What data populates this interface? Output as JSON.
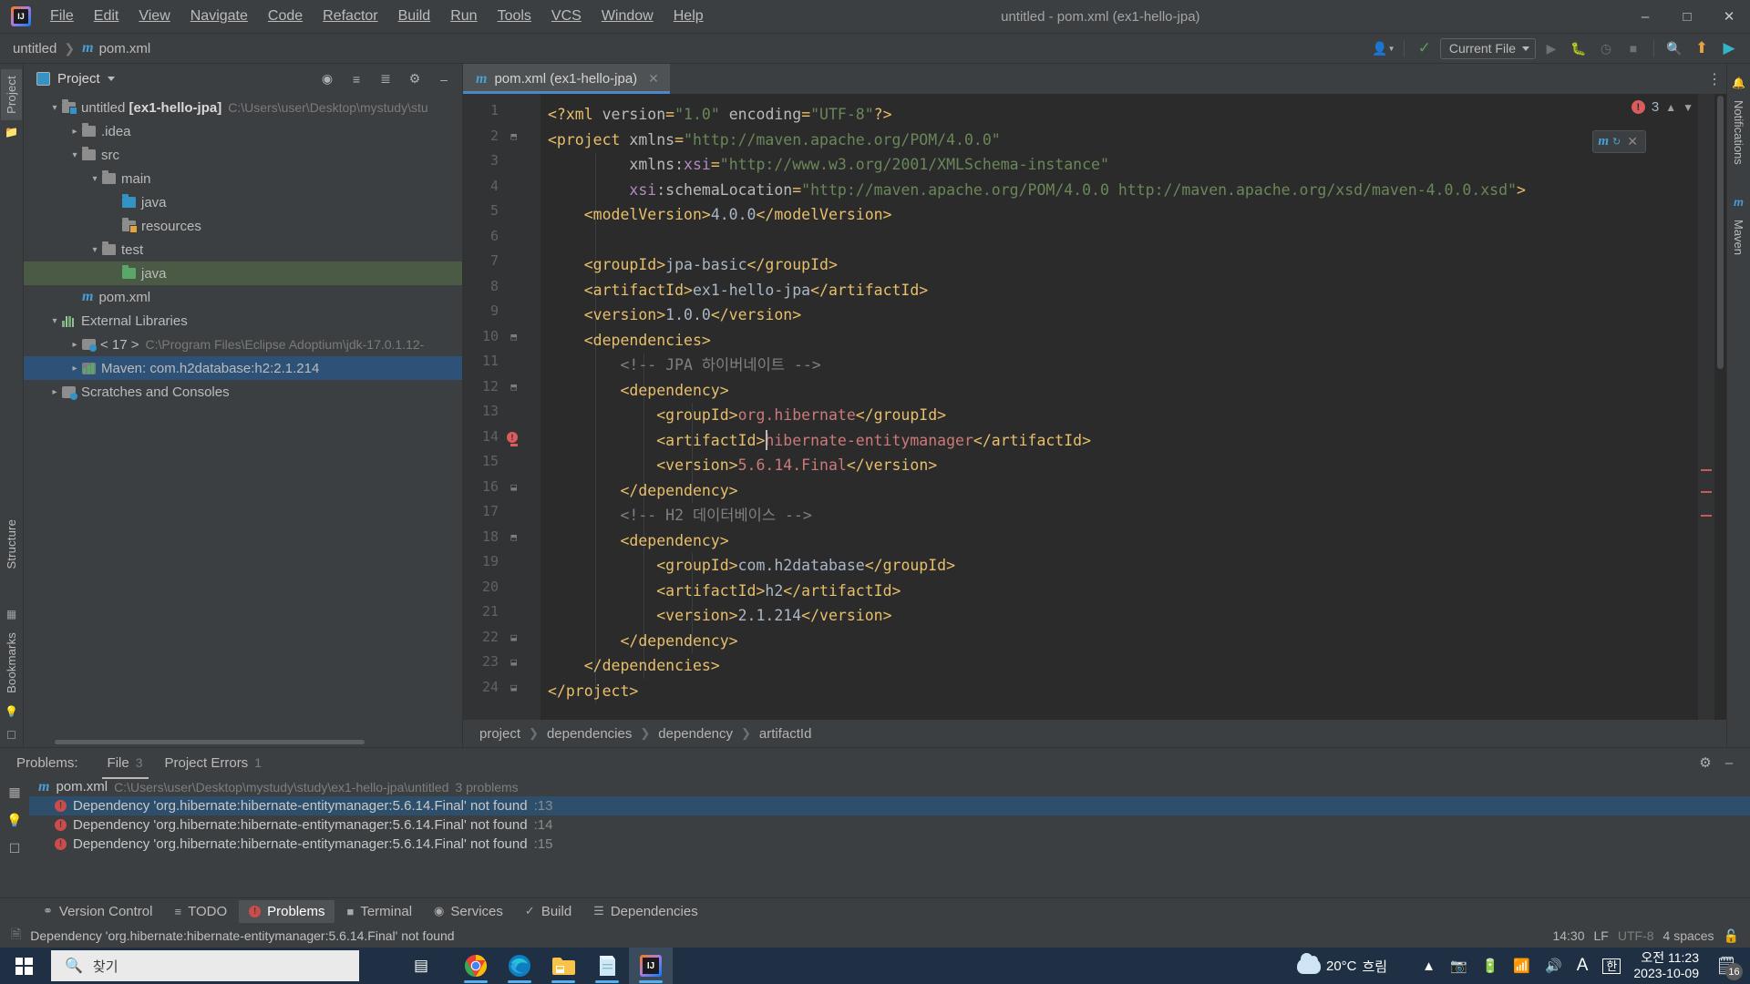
{
  "window": {
    "title": "untitled - pom.xml (ex1-hello-jpa)"
  },
  "menubar": {
    "items": [
      "File",
      "Edit",
      "View",
      "Navigate",
      "Code",
      "Refactor",
      "Build",
      "Run",
      "Tools",
      "VCS",
      "Window",
      "Help"
    ]
  },
  "navbar": {
    "crumbs": [
      "untitled",
      "pom.xml"
    ],
    "run_config": "Current File",
    "icons": [
      "account-icon",
      "hammer-build-icon",
      "run-icon",
      "debug-icon",
      "run-coverage-icon",
      "stop-icon",
      "search-everywhere-icon",
      "update-project-icon",
      "ide-services-icon"
    ]
  },
  "window_controls": {
    "minimize": "minimize-icon",
    "maximize": "maximize-icon",
    "close": "close-icon"
  },
  "left_strip": {
    "tabs": [
      "Project",
      "Structure",
      "Bookmarks"
    ]
  },
  "right_strip": {
    "tabs": [
      "Notifications",
      "Maven"
    ]
  },
  "project_panel": {
    "title": "Project",
    "header_icons": [
      "locate-file-icon",
      "expand-all-icon",
      "collapse-all-icon",
      "settings-gear-icon",
      "hide-panel-icon"
    ],
    "tree": [
      {
        "depth": 0,
        "arrow": "down",
        "icon": "module-folder-icon",
        "label": "untitled",
        "bold": "[ex1-hello-jpa]",
        "path": "C:\\Users\\user\\Desktop\\mystudy\\stu",
        "state": "normal"
      },
      {
        "depth": 1,
        "arrow": "right",
        "icon": "folder-icon",
        "label": ".idea",
        "state": "normal"
      },
      {
        "depth": 1,
        "arrow": "down",
        "icon": "folder-icon",
        "label": "src",
        "state": "normal"
      },
      {
        "depth": 2,
        "arrow": "down",
        "icon": "folder-icon",
        "label": "main",
        "state": "normal"
      },
      {
        "depth": 3,
        "arrow": "none",
        "icon": "source-folder-icon",
        "label": "java",
        "state": "normal"
      },
      {
        "depth": 3,
        "arrow": "none",
        "icon": "resource-folder-icon",
        "label": "resources",
        "state": "normal"
      },
      {
        "depth": 2,
        "arrow": "down",
        "icon": "folder-icon",
        "label": "test",
        "state": "normal"
      },
      {
        "depth": 3,
        "arrow": "none",
        "icon": "test-source-folder-icon",
        "label": "java",
        "state": "selected-green"
      },
      {
        "depth": 1,
        "arrow": "none",
        "icon": "maven-file-icon",
        "label": "pom.xml",
        "state": "normal"
      },
      {
        "depth": 0,
        "arrow": "down",
        "icon": "external-libraries-icon",
        "label": "External Libraries",
        "state": "normal"
      },
      {
        "depth": 1,
        "arrow": "right",
        "icon": "jdk-icon",
        "label": "< 17 >",
        "path": "C:\\Program Files\\Eclipse Adoptium\\jdk-17.0.1.12-",
        "state": "normal"
      },
      {
        "depth": 1,
        "arrow": "right",
        "icon": "maven-library-icon",
        "label": "Maven: com.h2database:h2:2.1.214",
        "state": "selected-blue"
      },
      {
        "depth": 0,
        "arrow": "right",
        "icon": "scratches-icon",
        "label": "Scratches and Consoles",
        "state": "normal"
      }
    ]
  },
  "editor": {
    "tab": {
      "label": "pom.xml (ex1-hello-jpa)",
      "icon": "maven-file-icon",
      "close": "close-icon"
    },
    "inspection_widget": {
      "error_count": "3",
      "up": "chevron-up-icon",
      "down": "chevron-down-icon"
    },
    "float_widget": {
      "icon": "maven-refresh-icon",
      "close": "close-icon"
    },
    "breadcrumbs": [
      "project",
      "dependencies",
      "dependency",
      "artifactId"
    ],
    "total_lines": 24,
    "gutter_error_line": 14,
    "lines": [
      {
        "n": 1,
        "fold": "",
        "tokens": [
          {
            "t": "<?xml ",
            "c": "prolog"
          },
          {
            "t": "version",
            "c": "attrn"
          },
          {
            "t": "=",
            "c": "tagp"
          },
          {
            "t": "\"1.0\"",
            "c": "str"
          },
          {
            "t": " ",
            "c": "txt"
          },
          {
            "t": "encoding",
            "c": "attrn"
          },
          {
            "t": "=",
            "c": "tagp"
          },
          {
            "t": "\"UTF-8\"",
            "c": "str"
          },
          {
            "t": "?>",
            "c": "prolog"
          }
        ]
      },
      {
        "n": 2,
        "fold": "open",
        "tokens": [
          {
            "t": "<project ",
            "c": "tagp"
          },
          {
            "t": "xmlns",
            "c": "attrn"
          },
          {
            "t": "=",
            "c": "tagp"
          },
          {
            "t": "\"http://maven.apache.org/POM/4.0.0\"",
            "c": "str"
          }
        ]
      },
      {
        "n": 3,
        "fold": "",
        "tokens": [
          {
            "t": "         ",
            "c": "txt"
          },
          {
            "t": "xmlns:",
            "c": "attrn"
          },
          {
            "t": "xsi",
            "c": "ns"
          },
          {
            "t": "=",
            "c": "tagp"
          },
          {
            "t": "\"http://www.w3.org/2001/XMLSchema-instance\"",
            "c": "str"
          }
        ]
      },
      {
        "n": 4,
        "fold": "",
        "tokens": [
          {
            "t": "         ",
            "c": "txt"
          },
          {
            "t": "xsi",
            "c": "ns"
          },
          {
            "t": ":schemaLocation",
            "c": "attrn"
          },
          {
            "t": "=",
            "c": "tagp"
          },
          {
            "t": "\"http://maven.apache.org/POM/4.0.0 http://maven.apache.org/xsd/maven-4.0.0.xsd\"",
            "c": "str"
          },
          {
            "t": ">",
            "c": "tagp"
          }
        ]
      },
      {
        "n": 5,
        "fold": "",
        "tokens": [
          {
            "t": "    <modelVersion>",
            "c": "tagp"
          },
          {
            "t": "4.0.0",
            "c": "txt"
          },
          {
            "t": "</modelVersion>",
            "c": "tagp"
          }
        ]
      },
      {
        "n": 6,
        "fold": "",
        "tokens": []
      },
      {
        "n": 7,
        "fold": "",
        "tokens": [
          {
            "t": "    <groupId>",
            "c": "tagp"
          },
          {
            "t": "jpa-basic",
            "c": "txt"
          },
          {
            "t": "</groupId>",
            "c": "tagp"
          }
        ]
      },
      {
        "n": 8,
        "fold": "",
        "tokens": [
          {
            "t": "    <artifactId>",
            "c": "tagp"
          },
          {
            "t": "ex1-hello-jpa",
            "c": "txt"
          },
          {
            "t": "</artifactId>",
            "c": "tagp"
          }
        ]
      },
      {
        "n": 9,
        "fold": "",
        "tokens": [
          {
            "t": "    <version>",
            "c": "tagp"
          },
          {
            "t": "1.0.0",
            "c": "txt"
          },
          {
            "t": "</version>",
            "c": "tagp"
          }
        ]
      },
      {
        "n": 10,
        "fold": "open",
        "tokens": [
          {
            "t": "    <dependencies>",
            "c": "tagp"
          }
        ]
      },
      {
        "n": 11,
        "fold": "",
        "tokens": [
          {
            "t": "        <!-- JPA 하이버네이트 -->",
            "c": "cmt"
          }
        ]
      },
      {
        "n": 12,
        "fold": "open",
        "tokens": [
          {
            "t": "        <dependency>",
            "c": "tagp"
          }
        ]
      },
      {
        "n": 13,
        "fold": "",
        "tokens": [
          {
            "t": "            <groupId>",
            "c": "tagp"
          },
          {
            "t": "org.hibernate",
            "c": "err"
          },
          {
            "t": "</groupId>",
            "c": "tagp"
          }
        ]
      },
      {
        "n": 14,
        "fold": "",
        "tokens": [
          {
            "t": "            <artifactId>",
            "c": "tagp"
          },
          {
            "t": "hibernate-entitymanager",
            "c": "err"
          },
          {
            "t": "</artifactId>",
            "c": "tagp"
          }
        ]
      },
      {
        "n": 15,
        "fold": "",
        "tokens": [
          {
            "t": "            <version>",
            "c": "tagp"
          },
          {
            "t": "5.6.14.Final",
            "c": "err"
          },
          {
            "t": "</version>",
            "c": "tagp"
          }
        ]
      },
      {
        "n": 16,
        "fold": "close",
        "tokens": [
          {
            "t": "        </dependency>",
            "c": "tagp"
          }
        ]
      },
      {
        "n": 17,
        "fold": "",
        "tokens": [
          {
            "t": "        <!-- H2 데이터베이스 -->",
            "c": "cmt"
          }
        ]
      },
      {
        "n": 18,
        "fold": "open",
        "tokens": [
          {
            "t": "        <dependency>",
            "c": "tagp"
          }
        ]
      },
      {
        "n": 19,
        "fold": "",
        "tokens": [
          {
            "t": "            <groupId>",
            "c": "tagp"
          },
          {
            "t": "com.h2database",
            "c": "txt"
          },
          {
            "t": "</groupId>",
            "c": "tagp"
          }
        ]
      },
      {
        "n": 20,
        "fold": "",
        "tokens": [
          {
            "t": "            <artifactId>",
            "c": "tagp"
          },
          {
            "t": "h2",
            "c": "txt"
          },
          {
            "t": "</artifactId>",
            "c": "tagp"
          }
        ]
      },
      {
        "n": 21,
        "fold": "",
        "tokens": [
          {
            "t": "            <version>",
            "c": "tagp"
          },
          {
            "t": "2.1.214",
            "c": "txt"
          },
          {
            "t": "</version>",
            "c": "tagp"
          }
        ]
      },
      {
        "n": 22,
        "fold": "close",
        "tokens": [
          {
            "t": "        </dependency>",
            "c": "tagp"
          }
        ]
      },
      {
        "n": 23,
        "fold": "close",
        "tokens": [
          {
            "t": "    </dependencies>",
            "c": "tagp"
          }
        ]
      },
      {
        "n": 24,
        "fold": "close",
        "tokens": [
          {
            "t": "</project>",
            "c": "tagp"
          }
        ]
      }
    ]
  },
  "problems": {
    "label": "Problems:",
    "tabs": [
      {
        "label": "File",
        "count": "3",
        "active": true
      },
      {
        "label": "Project Errors",
        "count": "1",
        "active": false
      }
    ],
    "header_icons": [
      "settings-gear-icon",
      "minimize-panel-icon"
    ],
    "strip_icons": [
      "group-by-icon",
      "show-quickfixes-icon",
      "preview-icon"
    ],
    "file": {
      "icon": "maven-file-icon",
      "name": "pom.xml",
      "path": "C:\\Users\\user\\Desktop\\mystudy\\study\\ex1-hello-jpa\\untitled",
      "summary": "3 problems"
    },
    "items": [
      {
        "text": "Dependency 'org.hibernate:hibernate-entitymanager:5.6.14.Final' not found",
        "line": ":13",
        "selected": true
      },
      {
        "text": "Dependency 'org.hibernate:hibernate-entitymanager:5.6.14.Final' not found",
        "line": ":14",
        "selected": false
      },
      {
        "text": "Dependency 'org.hibernate:hibernate-entitymanager:5.6.14.Final' not found",
        "line": ":15",
        "selected": false
      }
    ]
  },
  "tool_windows": [
    {
      "label": "Version Control",
      "icon": "branch-icon",
      "active": false
    },
    {
      "label": "TODO",
      "icon": "todo-list-icon",
      "active": false
    },
    {
      "label": "Problems",
      "icon": "error-circle-icon",
      "active": true
    },
    {
      "label": "Terminal",
      "icon": "terminal-icon",
      "active": false
    },
    {
      "label": "Services",
      "icon": "services-play-icon",
      "active": false
    },
    {
      "label": "Build",
      "icon": "hammer-build-icon",
      "active": false
    },
    {
      "label": "Dependencies",
      "icon": "layers-icon",
      "active": false
    }
  ],
  "statusbar": {
    "message": "Dependency 'org.hibernate:hibernate-entitymanager:5.6.14.Final' not found",
    "message_icon": "document-icon",
    "caret_position": "14:30",
    "line_separator": "LF",
    "encoding": "UTF-8",
    "indent": "4 spaces",
    "lock": "unlocked-padlock-icon"
  },
  "taskbar": {
    "start": "windows-start-icon",
    "search_placeholder": "찾기",
    "search_icon": "magnifier-icon",
    "taskview": "task-view-icon",
    "apps": [
      {
        "name": "chrome-icon",
        "running": true,
        "active": false
      },
      {
        "name": "edge-icon",
        "running": true,
        "active": false
      },
      {
        "name": "file-explorer-icon",
        "running": true,
        "active": false
      },
      {
        "name": "notepad-icon",
        "running": true,
        "active": false
      },
      {
        "name": "intellij-idea-icon",
        "running": true,
        "active": true
      }
    ],
    "weather": {
      "icon": "cloudy-icon",
      "temperature": "20°C",
      "condition": "흐림"
    },
    "tray": [
      "show-hidden-icons-chevron",
      "webcam-icon",
      "battery-icon",
      "wifi-icon",
      "volume-icon",
      "ime-A-icon",
      "ime-korean-icon"
    ],
    "clock": {
      "time": "오전 11:23",
      "date": "2023-10-09"
    },
    "notifications": {
      "icon": "notification-icon",
      "count": "16"
    }
  }
}
